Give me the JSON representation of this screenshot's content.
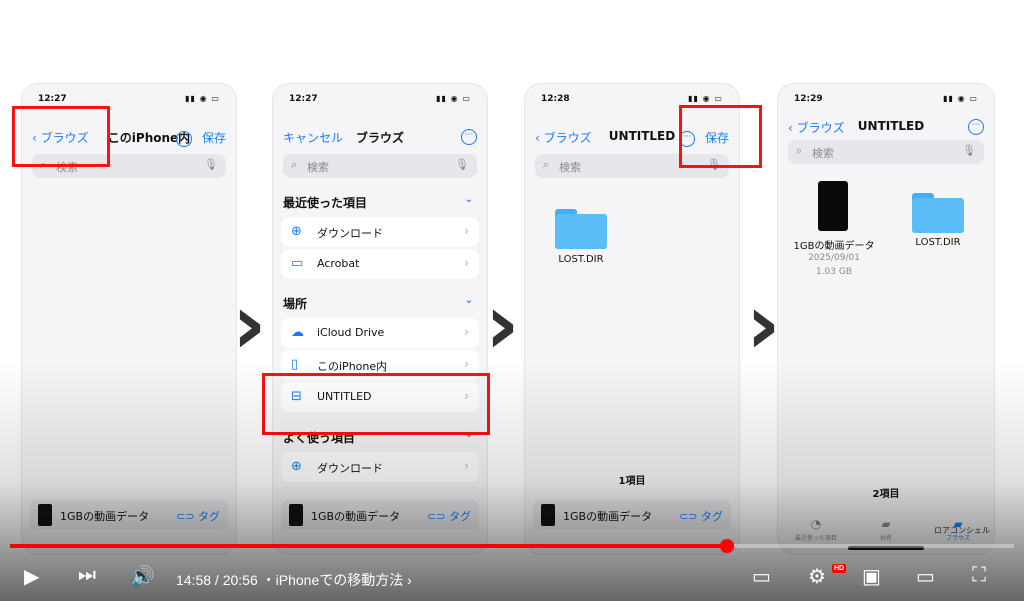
{
  "panel1": {
    "time": "12:27",
    "status_icons": "▮▮ ◉ ▭",
    "back_label": "ブラウズ",
    "title": "このiPhone内",
    "save_label": "保存",
    "search_placeholder": "検索",
    "bottom_file": "1GBの動画データ",
    "bottom_tag": "タグ"
  },
  "panel2": {
    "time": "12:27",
    "status_icons": "▮▮ ◉ ▭",
    "cancel_label": "キャンセル",
    "title": "ブラウズ",
    "search_placeholder": "検索",
    "recent_header": "最近使った項目",
    "recent_items": [
      "ダウンロード",
      "Acrobat"
    ],
    "locations_header": "場所",
    "location_items": [
      "iCloud Drive",
      "このiPhone内",
      "UNTITLED"
    ],
    "favorites_header": "よく使う項目",
    "favorite_items": [
      "ダウンロード"
    ],
    "bottom_file": "1GBの動画データ",
    "bottom_tag": "タグ"
  },
  "panel3": {
    "time": "12:28",
    "status_icons": "▮▮ ◉ ▭",
    "back_label": "ブラウズ",
    "title": "UNTITLED",
    "save_label": "保存",
    "search_placeholder": "検索",
    "folder_name": "LOST.DIR",
    "item_count": "1項目",
    "bottom_file": "1GBの動画データ",
    "bottom_tag": "タグ"
  },
  "panel4": {
    "time": "12:29",
    "status_icons": "▮▮ ◉ ▭",
    "back_label": "ブラウズ",
    "title": "UNTITLED",
    "search_placeholder": "検索",
    "file_name": "1GBの動画データ",
    "file_date": "2025/09/01",
    "file_size": "1.03 GB",
    "folder_name": "LOST.DIR",
    "item_count": "2項目",
    "tab_recent": "最近使った項目",
    "tab_shared": "共有",
    "tab_browse": "ブラウズ",
    "watermark": "ロアコンシェル"
  },
  "player": {
    "time_display": "14:58 / 20:56",
    "chapter": "・iPhoneでの移動方法",
    "chapter_arrow": "›",
    "progress": 0.714,
    "hd_badge": "HD"
  },
  "icons": [
    "play-icon",
    "next-icon",
    "volume-icon",
    "subtitles-icon",
    "settings-icon",
    "miniplayer-icon",
    "theater-icon",
    "fullscreen-icon"
  ],
  "colors": {
    "accent": "#1a7cf5",
    "highlight": "#ff1010",
    "progress": "#ff0000"
  }
}
